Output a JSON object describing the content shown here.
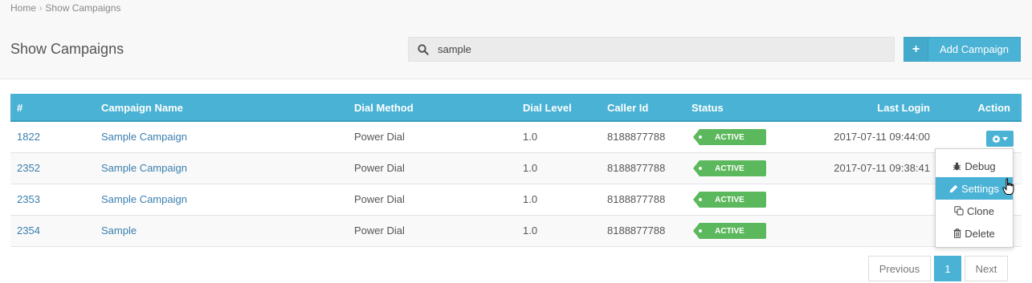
{
  "breadcrumb": {
    "home": "Home",
    "current": "Show Campaigns"
  },
  "page": {
    "title": "Show Campaigns"
  },
  "search": {
    "value": "sample"
  },
  "toolbar": {
    "add_label": "Add Campaign"
  },
  "table": {
    "headers": {
      "id": "#",
      "name": "Campaign Name",
      "dial_method": "Dial Method",
      "dial_level": "Dial Level",
      "caller_id": "Caller Id",
      "status": "Status",
      "last_login": "Last Login",
      "action": "Action"
    },
    "rows": [
      {
        "id": "1822",
        "name": "Sample Campaign",
        "dial_method": "Power Dial",
        "dial_level": "1.0",
        "caller_id": "8188877788",
        "status": "ACTIVE",
        "last_login": "2017-07-11 09:44:00"
      },
      {
        "id": "2352",
        "name": "Sample Campaign",
        "dial_method": "Power Dial",
        "dial_level": "1.0",
        "caller_id": "8188877788",
        "status": "ACTIVE",
        "last_login": "2017-07-11 09:38:41"
      },
      {
        "id": "2353",
        "name": "Sample Campaign",
        "dial_method": "Power Dial",
        "dial_level": "1.0",
        "caller_id": "8188877788",
        "status": "ACTIVE",
        "last_login": ""
      },
      {
        "id": "2354",
        "name": "Sample",
        "dial_method": "Power Dial",
        "dial_level": "1.0",
        "caller_id": "8188877788",
        "status": "ACTIVE",
        "last_login": ""
      }
    ]
  },
  "action_menu": {
    "items": [
      {
        "label": "Debug",
        "icon": "bug-icon"
      },
      {
        "label": "Settings",
        "icon": "pencil-icon"
      },
      {
        "label": "Clone",
        "icon": "copy-icon"
      },
      {
        "label": "Delete",
        "icon": "trash-icon"
      }
    ]
  },
  "pagination": {
    "prev": "Previous",
    "current": "1",
    "next": "Next"
  },
  "colors": {
    "accent": "#4ab2d4",
    "active_badge": "#5cb85c",
    "link": "#3a7fae"
  }
}
